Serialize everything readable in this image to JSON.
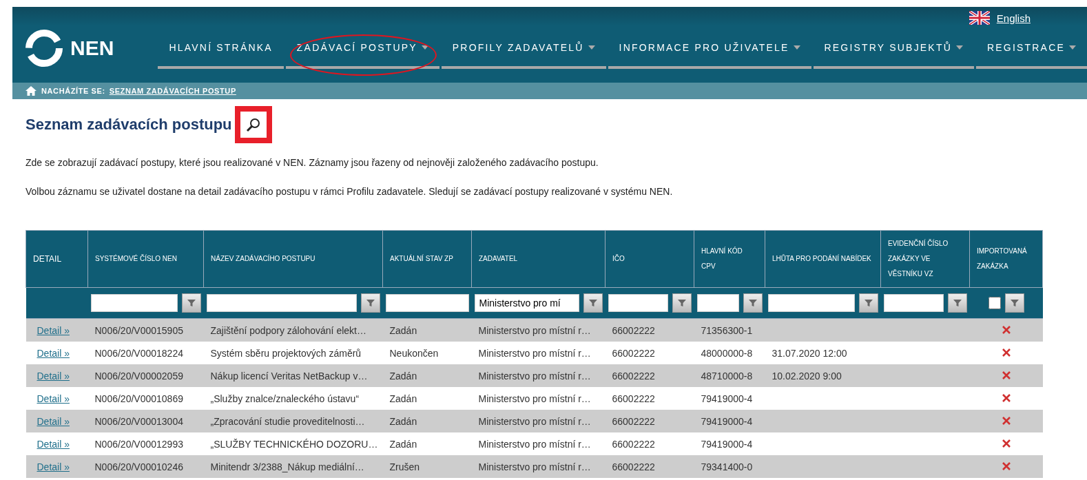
{
  "header": {
    "logo": "NEN",
    "language": "English",
    "nav": [
      {
        "label": "HLAVNÍ STRÁNKA",
        "has_menu": false,
        "highlighted": false
      },
      {
        "label": "ZADÁVACÍ POSTUPY",
        "has_menu": true,
        "highlighted": true
      },
      {
        "label": "PROFILY ZADAVATELŮ",
        "has_menu": true,
        "highlighted": false
      },
      {
        "label": "INFORMACE PRO UŽIVATELE",
        "has_menu": true,
        "highlighted": false
      },
      {
        "label": "REGISTRY SUBJEKTŮ",
        "has_menu": true,
        "highlighted": false
      },
      {
        "label": "REGISTRACE",
        "has_menu": true,
        "highlighted": false
      }
    ]
  },
  "breadcrumb": {
    "label": "NACHÁZÍTE SE:",
    "current": "SEZNAM ZADÁVACÍCH POSTUP"
  },
  "page": {
    "title": "Seznam zadávacích postupu",
    "search_highlighted": true,
    "paragraphs": [
      "Zde se zobrazují zadávací postupy, které jsou realizované v NEN. Záznamy jsou řazeny od nejnověji založeného zadávacího postupu.",
      "Volbou záznamu se uživatel dostane na detail zadávacího postupu v rámci Profilu zadavatele. Sledují se zadávací postupy realizované v systému NEN."
    ]
  },
  "table": {
    "columns": [
      {
        "label": "DETAIL",
        "kind": "none"
      },
      {
        "label": "SYSTÉMOVÉ ČÍSLO NEN",
        "kind": "text"
      },
      {
        "label": "NÁZEV ZADÁVACÍHO POSTUPU",
        "kind": "text"
      },
      {
        "label": "AKTUÁLNÍ STAV ZP",
        "kind": "input"
      },
      {
        "label": "ZADAVATEL",
        "kind": "text",
        "value": "Ministerstvo pro mí"
      },
      {
        "label": "IČO",
        "kind": "text"
      },
      {
        "label": "HLAVNÍ KÓD CPV",
        "kind": "text"
      },
      {
        "label": "LHŮTA PRO PODÁNÍ NABÍDEK",
        "kind": "text"
      },
      {
        "label": "EVIDENČNÍ ČÍSLO ZAKÁZKY VE VĚSTNÍKU VZ",
        "kind": "text"
      },
      {
        "label": "IMPORTOVANÁ ZAKÁZKA",
        "kind": "checkbox",
        "checked": false
      }
    ],
    "rows": [
      {
        "link": "Detail »",
        "number": "N006/20/V00015905",
        "name": "Zajištění podpory zálohování elekt…",
        "state": "Zadán",
        "authority": "Ministerstvo pro místní r…",
        "ico": "66002222",
        "cpv": "71356300-1",
        "deadline": "",
        "imported": false
      },
      {
        "link": "Detail »",
        "number": "N006/20/V00018224",
        "name": "Systém sběru projektových záměrů",
        "state": "Neukončen",
        "authority": "Ministerstvo pro místní r…",
        "ico": "66002222",
        "cpv": "48000000-8",
        "deadline": "31.07.2020 12:00",
        "imported": false
      },
      {
        "link": "Detail »",
        "number": "N006/20/V00002059",
        "name": "Nákup licencí Veritas NetBackup v…",
        "state": "Zadán",
        "authority": "Ministerstvo pro místní r…",
        "ico": "66002222",
        "cpv": "48710000-8",
        "deadline": "10.02.2020 9:00",
        "imported": false
      },
      {
        "link": "Detail »",
        "number": "N006/20/V00010869",
        "name": "„Služby znalce/znaleckého ústavu“",
        "state": "Zadán",
        "authority": "Ministerstvo pro místní r…",
        "ico": "66002222",
        "cpv": "79419000-4",
        "deadline": "",
        "imported": false
      },
      {
        "link": "Detail »",
        "number": "N006/20/V00013004",
        "name": "„Zpracování studie proveditelnosti…",
        "state": "Zadán",
        "authority": "Ministerstvo pro místní r…",
        "ico": "66002222",
        "cpv": "79419000-4",
        "deadline": "",
        "imported": false
      },
      {
        "link": "Detail »",
        "number": "N006/20/V00012993",
        "name": "„SLUŽBY TECHNICKÉHO DOZORU…",
        "state": "Zadán",
        "authority": "Ministerstvo pro místní r…",
        "ico": "66002222",
        "cpv": "79419000-4",
        "deadline": "",
        "imported": false
      },
      {
        "link": "Detail »",
        "number": "N006/20/V00010246",
        "name": "Minitendr 3/2388_Nákup mediální…",
        "state": "Zrušen",
        "authority": "Ministerstvo pro místní r…",
        "ico": "66002222",
        "cpv": "79341400-0",
        "deadline": "",
        "imported": false
      }
    ]
  }
}
